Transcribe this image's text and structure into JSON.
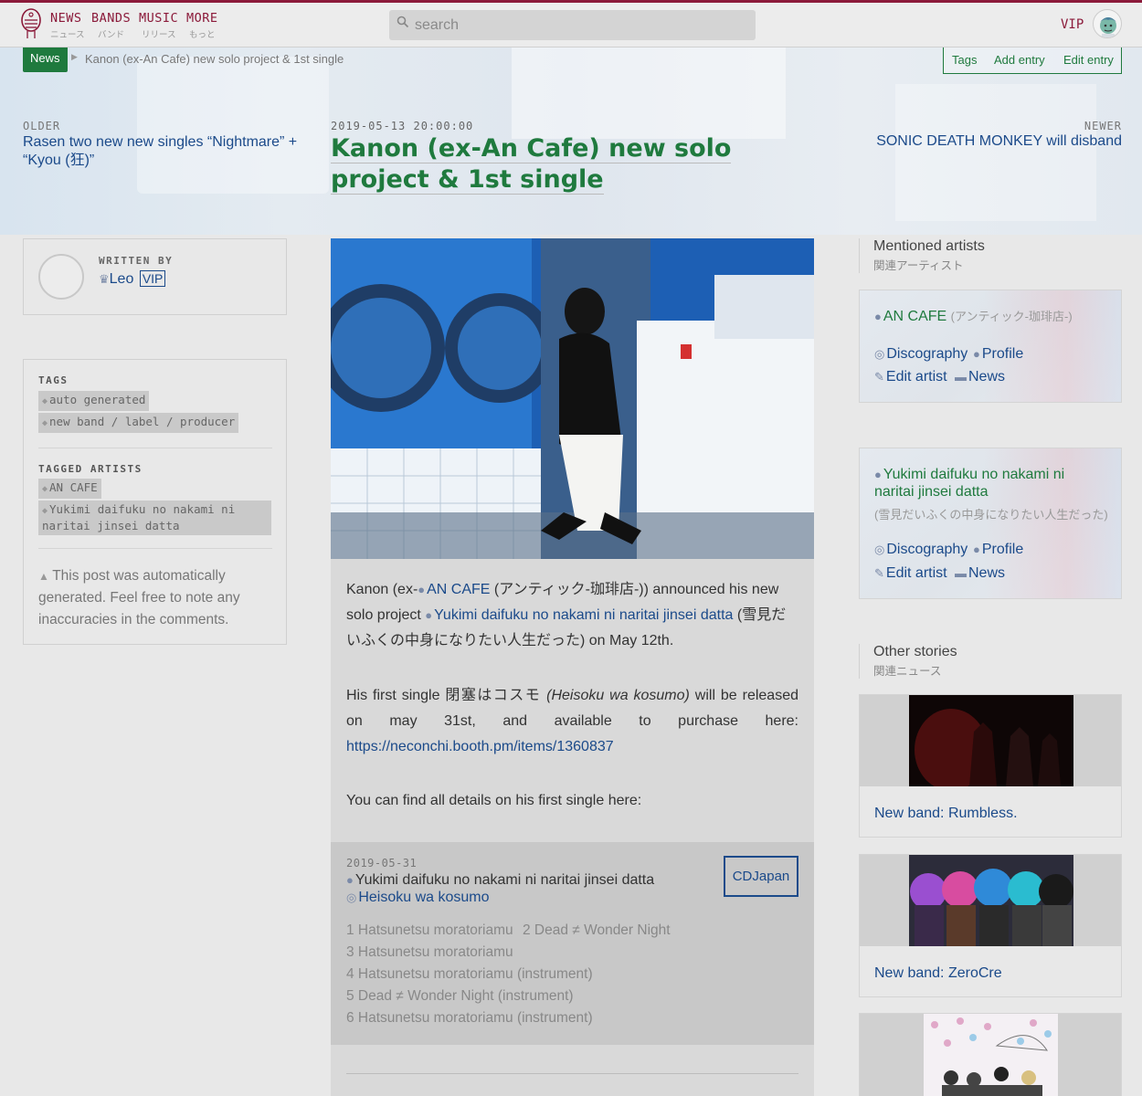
{
  "nav": {
    "items": [
      {
        "label": "NEWS",
        "sub": "ニュース"
      },
      {
        "label": "BANDS",
        "sub": "バンド"
      },
      {
        "label": "MUSIC",
        "sub": "リリース"
      },
      {
        "label": "MORE",
        "sub": "もっと"
      }
    ],
    "search_placeholder": "search",
    "vip_label": "VIP"
  },
  "breadcrumb": {
    "section": "News",
    "current": "Kanon (ex-An Cafe) new solo project & 1st single"
  },
  "entry_actions": [
    "Tags",
    "Add entry",
    "Edit entry"
  ],
  "pager": {
    "older_label": "OLDER",
    "older_title": "Rasen two new new singles “Nightmare” + “Kyou (狂)”",
    "newer_label": "NEWER",
    "newer_title": "SONIC DEATH MONKEY will disband"
  },
  "article": {
    "date": "2019-05-13 20:00:00",
    "title": "Kanon (ex-An Cafe) new solo project & 1st single",
    "p1_a": "Kanon (ex-",
    "p1_artist1": "AN CAFE",
    "p1_b": " (アンティック-珈琲店-)) announced his new solo project ",
    "p1_artist2": "Yukimi daifuku no nakami ni naritai jinsei datta",
    "p1_c": " (雪見だいふくの中身になりたい人生だった) on May 12th.",
    "p2_a": "His first single 閉塞はコスモ ",
    "p2_italic": "(Heisoku wa kosumo)",
    "p2_b": " will be released on may 31st, and available to purchase here:",
    "p2_link": "https://neconchi.booth.pm/items/1360837",
    "p3": "You can find all details on his first single here:"
  },
  "release": {
    "date": "2019-05-31",
    "artist": "Yukimi daifuku no nakami ni naritai jinsei datta",
    "title": "Heisoku wa kosumo",
    "shop": "CDJapan",
    "tracks": [
      "1 Hatsunetsu moratoriamu",
      "2 Dead ≠ Wonder Night",
      "3 Hatsunetsu moratoriamu",
      "4 Hatsunetsu moratoriamu (instrument)",
      "5 Dead ≠ Wonder Night (instrument)",
      "6 Hatsunetsu moratoriamu (instrument)"
    ]
  },
  "author": {
    "label": "WRITTEN BY",
    "name": "Leo",
    "badge": "VIP"
  },
  "tags_box": {
    "tags_label": "TAGS",
    "tags": [
      "auto generated",
      "new band / label / producer"
    ],
    "artists_label": "TAGGED ARTISTS",
    "artists": [
      "AN CAFE",
      "Yukimi daifuku no nakami ni naritai jinsei datta"
    ],
    "note": "This post was automatically generated. Feel free to note any inaccuracies in the comments."
  },
  "mentioned": {
    "title": "Mentioned artists",
    "subtitle": "関連アーティスト",
    "artists": [
      {
        "name": "AN CAFE",
        "jp": "(アンティック-珈琲店-)"
      },
      {
        "name": "Yukimi daifuku no nakami ni naritai jinsei datta",
        "jp": "(雪見だいふくの中身になりたい人生だった)"
      }
    ],
    "links": {
      "discography": "Discography",
      "profile": "Profile",
      "edit": "Edit artist",
      "news": "News"
    }
  },
  "other": {
    "title": "Other stories",
    "subtitle": "関連ニュース",
    "stories": [
      "New band: Rumbless.",
      "New band: ZeroCre"
    ]
  },
  "colors": {
    "accent": "#8b1a3a",
    "green": "#1f7a3e",
    "link": "#1b4a8a"
  }
}
